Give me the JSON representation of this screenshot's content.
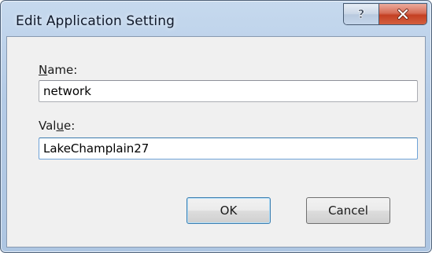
{
  "window": {
    "title": "Edit Application Setting",
    "help_glyph": "?",
    "close_glyph": "X"
  },
  "form": {
    "name_label_prefix": "N",
    "name_label_rest": "ame:",
    "name_value": "network",
    "value_label_prefix": "Val",
    "value_label_accel": "u",
    "value_label_suffix": "e:",
    "value_value": "LakeChamplain27"
  },
  "buttons": {
    "ok_label": "OK",
    "cancel_label": "Cancel"
  },
  "icons": {
    "help": "question-mark-icon",
    "close": "close-icon"
  }
}
